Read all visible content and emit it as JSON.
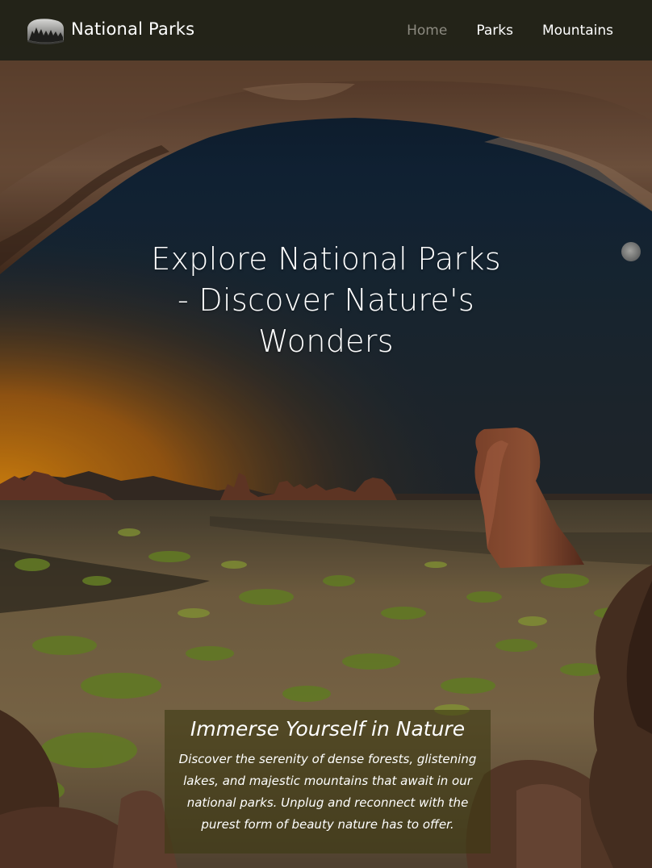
{
  "navbar": {
    "brand": "National Parks",
    "logo_icon": "mountain-forest-logo-icon",
    "links": [
      {
        "label": "Home",
        "active": true
      },
      {
        "label": "Parks",
        "active": false
      },
      {
        "label": "Mountains",
        "active": false
      }
    ]
  },
  "hero": {
    "title_line1": "Explore National Parks",
    "title_line2": "- Discover Nature's",
    "title_line3": "Wonders"
  },
  "info": {
    "heading": "Immerse Yourself in Nature",
    "text": "Discover the serenity of dense forests, glistening lakes, and majestic mountains that await in our national parks. Unplug and reconnect with the purest form of beauty nature has to offer."
  },
  "colors": {
    "navbar_bg": "#28261a",
    "nav_active": "#8c8a80",
    "nav_text": "#ffffff",
    "sky_top": "#0f1c2b",
    "sunset_glow": "#c87812",
    "rock": "#6b4632",
    "ground": "#7e6a48"
  }
}
